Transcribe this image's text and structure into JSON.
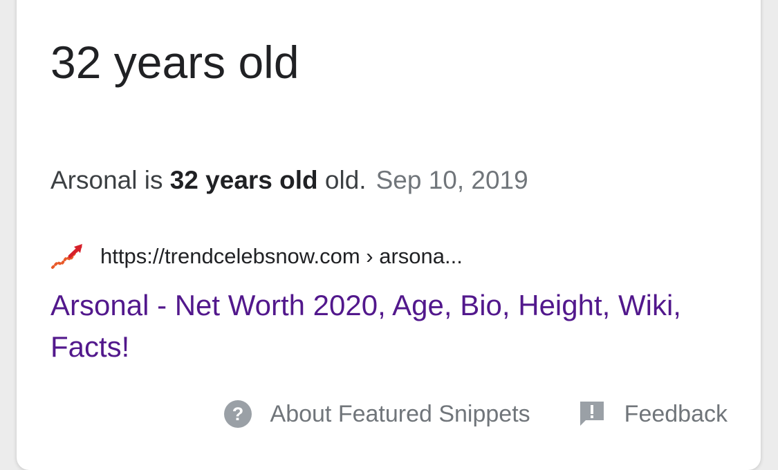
{
  "answer": {
    "heading": "32 years old"
  },
  "snippet": {
    "text_before": "Arsonal is ",
    "text_bold": "32 years old",
    "text_after": " old.",
    "date": "Sep 10, 2019"
  },
  "source": {
    "favicon": "trend-arrow-icon",
    "url": "https://trendcelebsnow.com › arsona...",
    "title": "Arsonal - Net Worth 2020, Age, Bio, Height, Wiki, Facts!"
  },
  "footer": {
    "about_icon": "help-circle-icon",
    "about_label": "About Featured Snippets",
    "feedback_icon": "feedback-icon",
    "feedback_label": "Feedback"
  },
  "colors": {
    "link": "#52188c",
    "muted": "#70757a",
    "text": "#202124"
  }
}
